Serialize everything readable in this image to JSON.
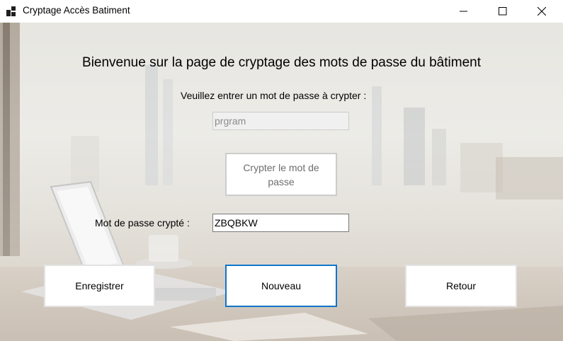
{
  "window": {
    "title": "Cryptage Accès Batiment",
    "controls": [
      "minimize-icon",
      "maximize-icon",
      "close-icon"
    ]
  },
  "main": {
    "heading": "Bienvenue sur la page de cryptage des mots de passe du bâtiment",
    "prompt_label": "Veuillez entrer un mot de passe à crypter :",
    "password_input": {
      "value": "prgram",
      "enabled": false
    },
    "crypt_button_label": "Crypter le mot de passe",
    "encrypted_label": "Mot de passe crypté :",
    "encrypted_value": "ZBQBKW"
  },
  "buttons": {
    "save": "Enregistrer",
    "new": "Nouveau",
    "back": "Retour"
  },
  "colors": {
    "focus_border": "#0f75c9",
    "disabled_input_bg": "#f0f0f0",
    "disabled_text": "#6d6d6d"
  }
}
